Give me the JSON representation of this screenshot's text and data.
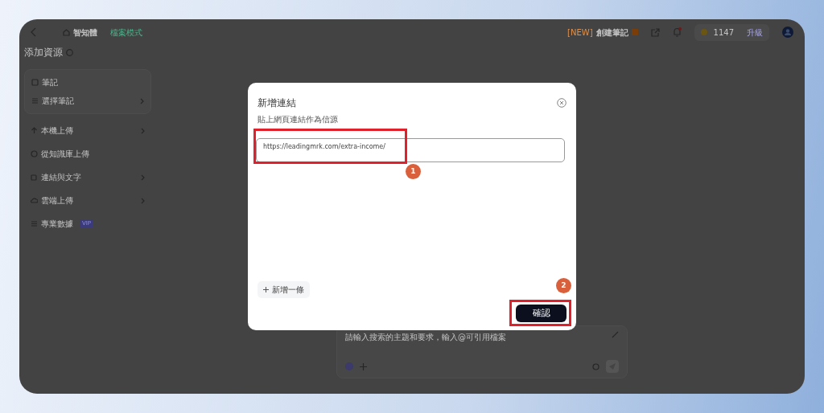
{
  "header": {
    "home": "智知體",
    "mode": "檔案模式",
    "promo": {
      "tag": "[NEW]",
      "title": "創建筆記"
    },
    "credits": "1147",
    "upgrade": "升級"
  },
  "sidebar": {
    "title": "添加資源",
    "note_card": {
      "title": "筆記",
      "action": "選擇筆記"
    },
    "items": [
      {
        "label": "本機上傳",
        "arrow": true
      },
      {
        "label": "從知識庫上傳",
        "arrow": false
      },
      {
        "label": "連結與文字",
        "arrow": true
      },
      {
        "label": "雲端上傳",
        "arrow": true
      },
      {
        "label": "專業數據",
        "arrow": false,
        "badge": "VIP"
      }
    ]
  },
  "modal": {
    "title": "新增連結",
    "field_label": "貼上網頁連結作為信源",
    "value": "https://leadingmrk.com/extra-income/",
    "add_row": "新增一條",
    "confirm": "確認"
  },
  "annotations": [
    {
      "number": "1"
    },
    {
      "number": "2"
    }
  ],
  "composer": {
    "placeholder": "請輸入搜索的主題和要求，輸入@可引用檔案"
  }
}
